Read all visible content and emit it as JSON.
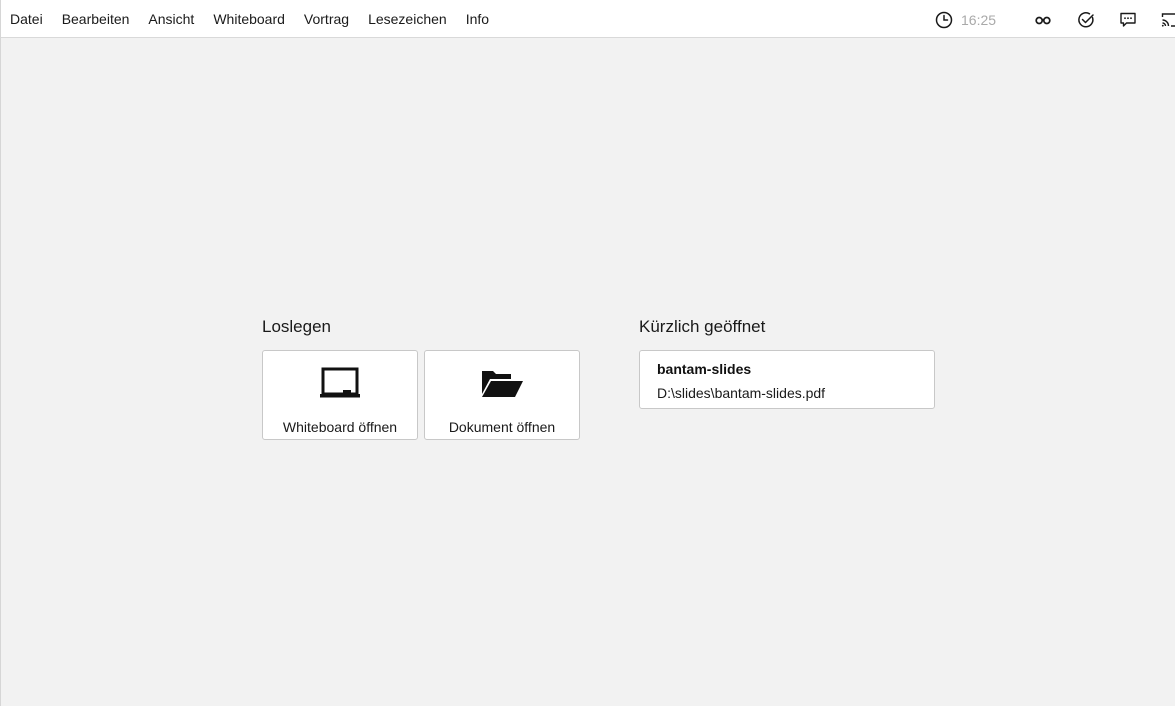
{
  "menu": {
    "items": [
      "Datei",
      "Bearbeiten",
      "Ansicht",
      "Whiteboard",
      "Vortrag",
      "Lesezeichen",
      "Info"
    ]
  },
  "toolbar": {
    "time": "16:25",
    "icons": [
      "clock-icon",
      "glasses-icon",
      "check-circle-icon",
      "speech-bubble-icon",
      "cast-icon"
    ],
    "muted_color": "#a9a9a9"
  },
  "start": {
    "title": "Loslegen",
    "whiteboard_label": "Whiteboard öffnen",
    "whiteboard_icon": "whiteboard-icon",
    "document_label": "Dokument öffnen",
    "document_icon": "folder-open-icon"
  },
  "recent": {
    "title": "Kürzlich geöffnet",
    "items": [
      {
        "name": "bantam-slides",
        "path": "D:\\slides\\bantam-slides.pdf"
      }
    ]
  },
  "colors": {
    "background": "#f2f2f2",
    "card": "#ffffff",
    "border": "#c8c8c8",
    "text": "#1a1a1a"
  }
}
